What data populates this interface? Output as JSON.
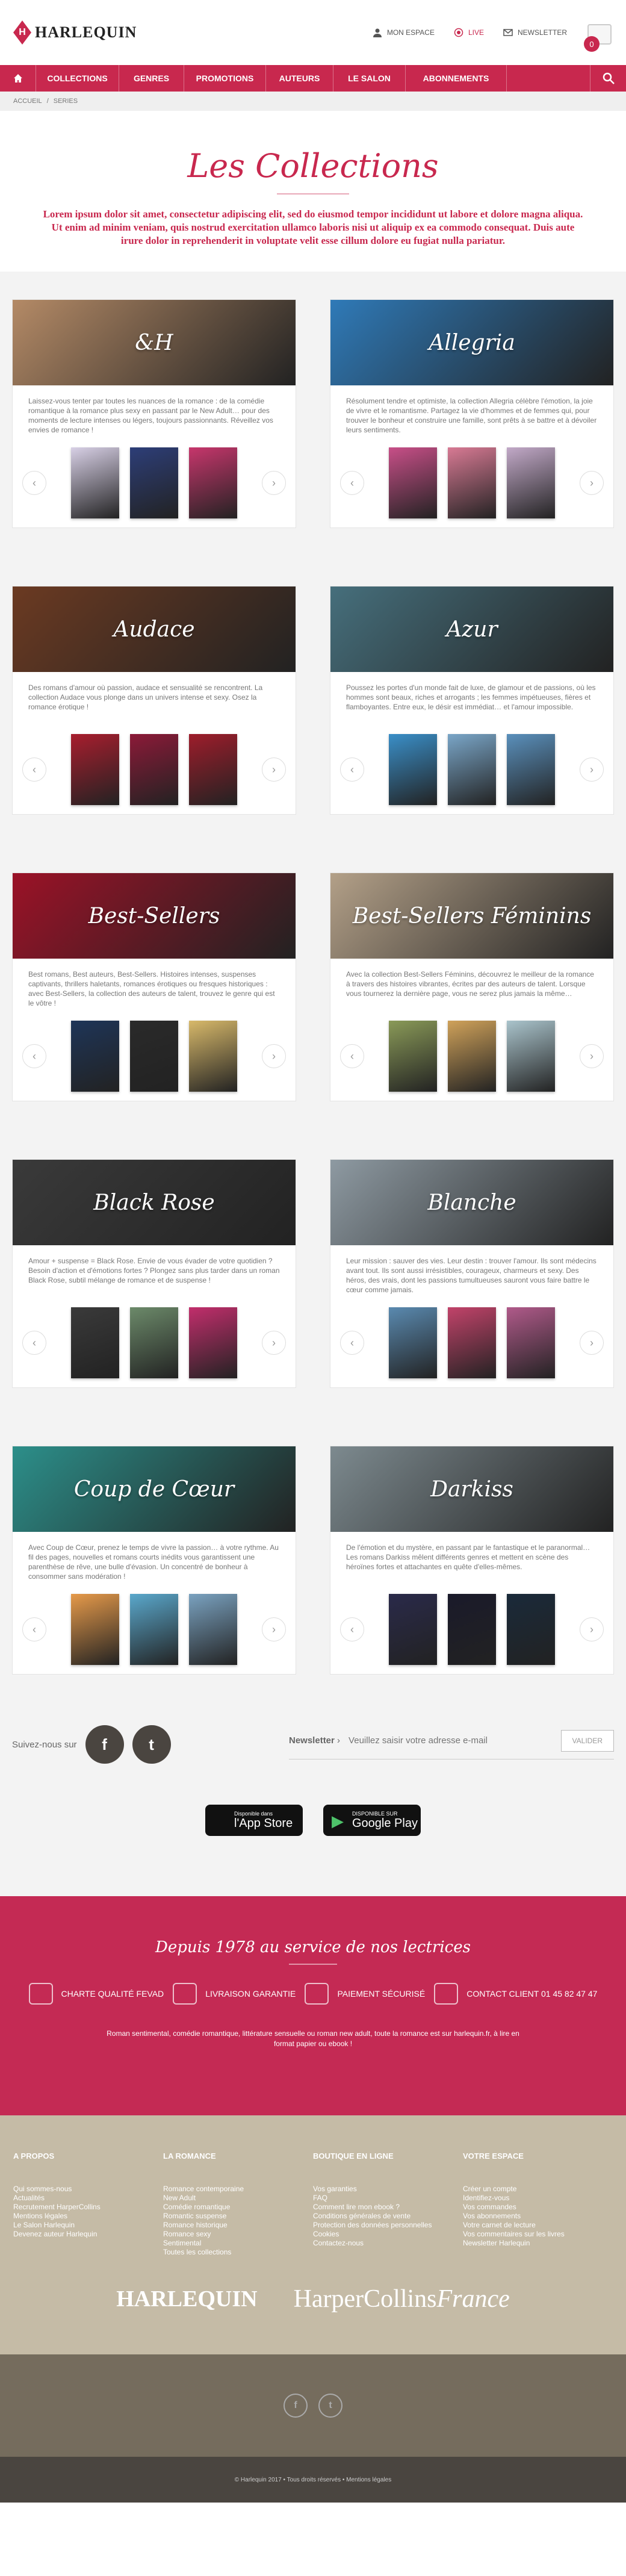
{
  "header": {
    "logo": "HARLEQUIN",
    "links": [
      {
        "label": "MON ESPACE",
        "icon": "user-icon"
      },
      {
        "label": "LIVE",
        "icon": "live-icon"
      },
      {
        "label": "NEWSLETTER",
        "icon": "mail-icon"
      }
    ],
    "cart_count": "0"
  },
  "nav": {
    "items": [
      "COLLECTIONS",
      "GENRES",
      "PROMOTIONS",
      "AUTEURS",
      "LE SALON",
      "ABONNEMENTS"
    ]
  },
  "breadcrumb": [
    "ACCUEIL",
    "SERIES"
  ],
  "hero": {
    "title": "Les Collections",
    "text": "Lorem ipsum dolor sit amet, consectetur adipiscing elit, sed do eiusmod tempor incididunt ut labore et dolore magna aliqua. Ut enim ad minim veniam, quis nostrud exercitation ullamco laboris nisi ut aliquip ex ea commodo consequat. Duis aute irure dolor in reprehenderit in voluptate velit esse cillum dolore eu fugiat nulla pariatur."
  },
  "collections": [
    {
      "title": "&H",
      "desc": "Laissez-vous tenter par toutes les nuances de la romance : de la comédie romantique à la romance plus sexy en passant par le New Adult… pour des moments de lecture intenses ou légers, toujours passionnants. Réveillez vos envies de romance !",
      "bg": "#b48a66",
      "books": [
        "#d8d0e6",
        "#2d3e78",
        "#c7366c"
      ]
    },
    {
      "title": "Allegria",
      "desc": "Résolument tendre et optimiste, la collection Allegria célèbre l'émotion, la joie de vivre et le romantisme. Partagez la vie d'hommes et de femmes qui, pour trouver le bonheur et construire une famille, sont prêts à se battre et à dévoiler leurs sentiments.",
      "bg": "#2f7ab8",
      "books": [
        "#c84f88",
        "#d87a94",
        "#c2a9c8"
      ]
    },
    {
      "title": "Audace",
      "desc": "Des romans d'amour où passion, audace et sensualité se rencontrent. La collection Audace vous plonge dans un univers intense et sexy. Osez la romance érotique !",
      "bg": "#6b3a22",
      "books": [
        "#a81e2e",
        "#8c1a38",
        "#9e1d2b"
      ]
    },
    {
      "title": "Azur",
      "desc": "Poussez les portes d'un monde fait de luxe, de glamour et de passions, où les hommes sont beaux, riches et arrogants ; les femmes impétueuses, fières et flamboyantes. Entre eux, le désir est immédiat… et l'amour impossible.",
      "bg": "#466f7c",
      "books": [
        "#3a8fc8",
        "#7aa6c8",
        "#5a90bc"
      ]
    },
    {
      "title": "Best-Sellers",
      "desc": "Best romans, Best auteurs, Best-Sellers. Histoires intenses, suspenses captivants, thrillers haletants, romances érotiques ou fresques historiques : avec Best-Sellers, la collection des auteurs de talent, trouvez le genre qui est le vôtre !",
      "bg": "#9b1227",
      "books": [
        "#1e3558",
        "#2a2a2a",
        "#d8b96a"
      ]
    },
    {
      "title": "Best-Sellers Féminins",
      "desc": "Avec la collection Best-Sellers Féminins, découvrez le meilleur de la romance à travers des histoires vibrantes, écrites par des auteurs de talent. Lorsque vous tournerez la dernière page, vous ne serez plus jamais la même…",
      "bg": "#b3a088",
      "books": [
        "#8a9a58",
        "#d0a25a",
        "#aac4cc"
      ]
    },
    {
      "title": "Black Rose",
      "desc": "Amour + suspense = Black Rose. Envie de vous évader de votre quotidien ? Besoin d'action et d'émotions fortes ? Plongez sans plus tarder dans un roman Black Rose, subtil mélange de romance et de suspense !",
      "bg": "#3a3a3a",
      "books": [
        "#3a3a3a",
        "#6c8a6a",
        "#c22e6c"
      ]
    },
    {
      "title": "Blanche",
      "desc": "Leur mission : sauver des vies. Leur destin : trouver l'amour. Ils sont médecins avant tout. Ils sont aussi irrésistibles, courageux, charmeurs et sexy. Des héros, des vrais, dont les passions tumultueuses sauront vous faire battre le cœur comme jamais.",
      "bg": "#8e9aa2",
      "books": [
        "#5a8ab0",
        "#c2436a",
        "#b05a8a"
      ]
    },
    {
      "title": "Coup de Cœur",
      "desc": "Avec Coup de Cœur, prenez le temps de vivre la passion… à votre rythme. Au fil des pages, nouvelles et romans courts inédits vous garantissent une parenthèse de rêve, une bulle d'évasion. Un concentré de bonheur à consommer sans modération !",
      "bg": "#2c8f8a",
      "books": [
        "#e69a4a",
        "#5aa8cc",
        "#7aa2c0"
      ]
    },
    {
      "title": "Darkiss",
      "desc": "De l'émotion et du mystère, en passant par le fantastique et le paranormal… Les romans Darkiss mêlent différents genres et mettent en scène des héroïnes fortes et attachantes en quête d'elles-mêmes.",
      "bg": "#7d8a8f",
      "books": [
        "#2a2a4a",
        "#1a1a2a",
        "#1a2a3a"
      ]
    }
  ],
  "social": {
    "follow_label": "Suivez-nous sur",
    "networks": [
      "f",
      "t"
    ],
    "newsletter_label": "Newsletter",
    "newsletter_separator": "›",
    "newsletter_placeholder": "Veuillez saisir votre adresse e-mail",
    "validate": "VALIDER"
  },
  "apps": [
    {
      "small": "Disponible dans",
      "big": "l'App Store",
      "glyph": "",
      "icon": "apple-icon"
    },
    {
      "small": "DISPONIBLE SUR",
      "big": "Google Play",
      "glyph": "▶",
      "icon": "google-play-icon"
    }
  ],
  "services": {
    "title": "Depuis 1978 au service de nos lectrices",
    "features": [
      {
        "label": "CHARTE QUALITÉ FEVAD",
        "icon": "thumbs-up-icon"
      },
      {
        "label": "LIVRAISON GARANTIE",
        "icon": "truck-icon"
      },
      {
        "label": "PAIEMENT SÉCURISÉ",
        "icon": "payment-icon"
      },
      {
        "label": "CONTACT CLIENT 01 45 82 47 47",
        "icon": "phone-icon"
      }
    ],
    "note": "Roman sentimental, comédie romantique, littérature sensuelle ou roman new adult, toute la romance est sur harlequin.fr, à lire en format papier ou ebook !"
  },
  "footer": {
    "columns": [
      {
        "title": "A PROPOS",
        "items": [
          "Qui sommes-nous",
          "Actualités",
          "Recrutement HarperCollins",
          "Mentions légales",
          "Le Salon Harlequin",
          "Devenez auteur Harlequin"
        ]
      },
      {
        "title": "LA ROMANCE",
        "items": [
          "Romance contemporaine",
          "New Adult",
          "Comédie romantique",
          "Romantic suspense",
          "Romance historique",
          "Romance sexy",
          "Sentimental",
          "Toutes les collections"
        ]
      },
      {
        "title": "BOUTIQUE EN LIGNE",
        "items": [
          "Vos garanties",
          "FAQ",
          "Comment lire mon ebook ?",
          "Conditions générales de vente",
          "Protection des données personnelles",
          "Cookies",
          "Contactez-nous"
        ]
      },
      {
        "title": "VOTRE ESPACE",
        "items": [
          "Créer un compte",
          "Identifiez-vous",
          "Vos commandes",
          "Vos abonnements",
          "Votre carnet de lecture",
          "Vos commentaires sur les livres",
          "Newsletter Harlequin"
        ]
      }
    ],
    "logo1": "HARLEQUIN",
    "logo2": "HarperCollins",
    "logo2_suffix": "France",
    "copyright": "© Harlequin 2017 • Tous droits réservés • Mentions légales"
  }
}
